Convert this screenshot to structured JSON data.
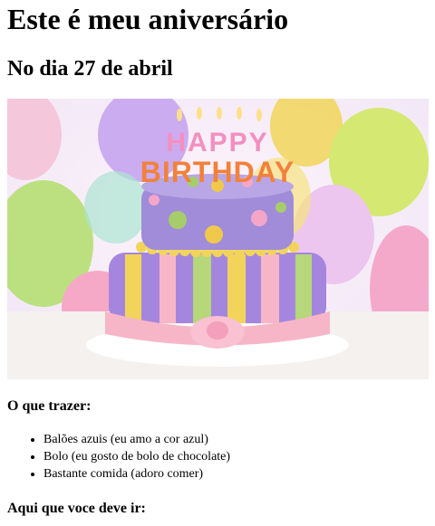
{
  "page": {
    "title": "Este é meu aniversário",
    "subtitle": "No dia 27 de abril",
    "image": {
      "banner_line1": "HAPPY",
      "banner_line2": "BIRTHDAY",
      "colors": {
        "cake_top": "#a08cd8",
        "cake_bottom": "#a586df",
        "ribbon": "#f7b6c8",
        "stripe_yellow": "#f2d45a",
        "stripe_green": "#b6d77a",
        "dot_green": "#a7cd6a",
        "dot_yellow": "#f0c94c"
      }
    },
    "bring_heading": "O que trazer:",
    "bring_items": [
      "Balões azuis (eu amo a cor azul)",
      "Bolo (eu gosto de bolo de chocolate)",
      "Bastante comida (adoro comer)"
    ],
    "location_heading": "Aqui que voce deve ir:"
  }
}
